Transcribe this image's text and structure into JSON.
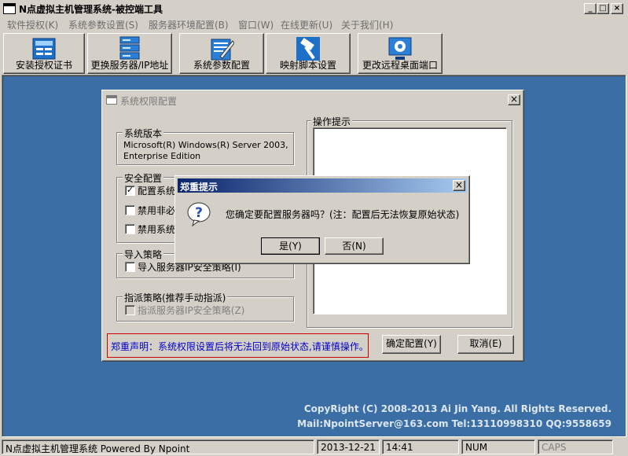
{
  "window": {
    "title": "N点虚拟主机管理系统-被控端工具"
  },
  "menu": [
    "软件授权(K)",
    "系统参数设置(S)",
    "服务器环境配置(B)",
    "窗口(W)",
    "在线更新(U)",
    "关于我们(H)"
  ],
  "toolbar": [
    {
      "label": "安装授权证书",
      "icon": "certificate-icon"
    },
    {
      "label": "更换服务器/IP地址",
      "icon": "server-icon"
    },
    {
      "label": "系统参数配置",
      "icon": "settings-document-icon"
    },
    {
      "label": "映射脚本设置",
      "icon": "hammer-icon"
    },
    {
      "label": "更改远程桌面端口",
      "icon": "remote-desktop-icon"
    }
  ],
  "perm_window": {
    "title": "系统权限配置",
    "version_group": "系统版本",
    "version_text_1": "Microsoft(R) Windows(R) Server 2003,",
    "version_text_2": "Enterprise Edition",
    "security_group": "安全配置",
    "security_items": [
      {
        "label": "配置系统",
        "checked": true
      },
      {
        "label": "禁用非必",
        "checked": false
      },
      {
        "label": "禁用系统",
        "checked": false
      }
    ],
    "import_group": "导入策略",
    "import_item": "导入服务器IP安全策略(I)",
    "assign_group": "指派策略(推荐手动指派)",
    "assign_item": "指派服务器IP安全策略(Z)",
    "hint_group": "操作提示",
    "warning": "郑重声明：系统权限设置后将无法回到原始状态,请谨慎操作。",
    "confirm_button": "确定配置(Y)",
    "cancel_button": "取消(E)"
  },
  "dialog": {
    "title": "郑重提示",
    "message": "您确定要配置服务器吗？(注：配置后无法恢复原始状态)",
    "yes_button": "是(Y)",
    "no_button": "否(N)"
  },
  "copyright": {
    "line1": "CopyRight (C) 2008-2013 Ai Jin Yang. All Rights Reserved.",
    "line2": "Mail:NpointServer@163.com Tel:13110998310 QQ:9558659"
  },
  "status": {
    "app": "N点虚拟主机管理系统 Powered By Npoint",
    "date": "2013-12-21",
    "time": "14:41",
    "num": "NUM",
    "caps": "CAPS"
  },
  "colors": {
    "desktop": "#3a6ea5",
    "warning_text": "#0000cc",
    "warning_border": "#cc0000"
  }
}
